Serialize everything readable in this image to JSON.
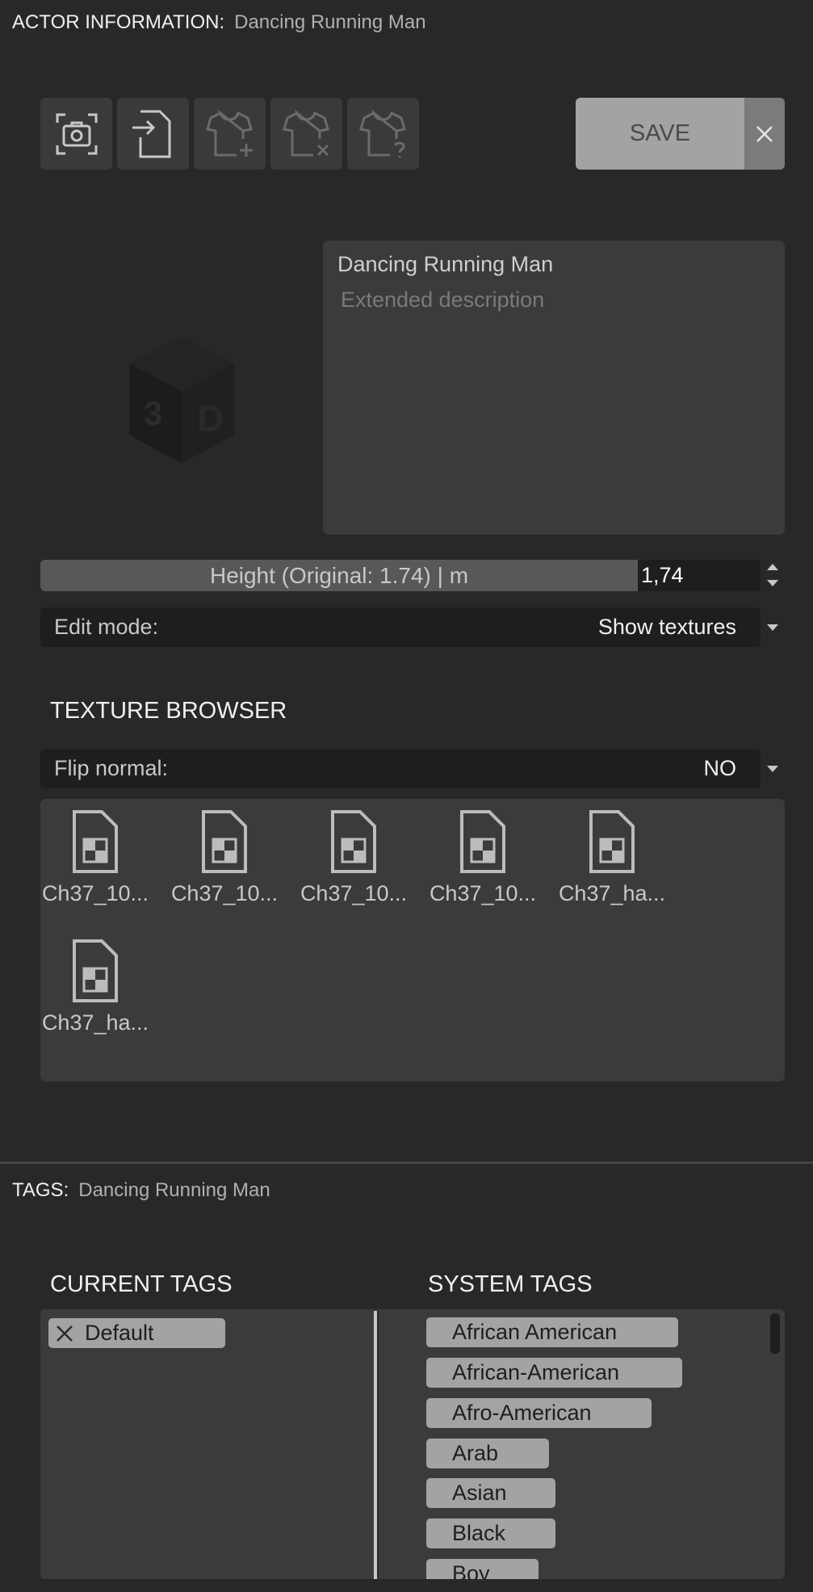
{
  "actor_panel": {
    "header_label": "ACTOR INFORMATION:",
    "header_name": "Dancing Running Man"
  },
  "toolbar": {
    "buttons": [
      {
        "icon": "camera-icon",
        "enabled": true
      },
      {
        "icon": "import-file-icon",
        "enabled": true
      },
      {
        "icon": "shirt-add-icon",
        "enabled": false
      },
      {
        "icon": "shirt-remove-icon",
        "enabled": false
      },
      {
        "icon": "shirt-help-icon",
        "enabled": false
      }
    ],
    "save_label": "SAVE",
    "close_icon": "close-icon"
  },
  "preview": {
    "icon": "3d-cube-icon"
  },
  "description": {
    "title": "Dancing Running Man",
    "placeholder": "Extended description"
  },
  "height": {
    "label": "Height (Original: 1.74) | m",
    "value": "1,74"
  },
  "edit_mode": {
    "label": "Edit mode:",
    "value": "Show textures"
  },
  "texture_browser": {
    "title": "TEXTURE BROWSER",
    "flip_normal_label": "Flip normal:",
    "flip_normal_value": "NO",
    "items": [
      {
        "name": "Ch37_10..."
      },
      {
        "name": "Ch37_10..."
      },
      {
        "name": "Ch37_10..."
      },
      {
        "name": "Ch37_10..."
      },
      {
        "name": "Ch37_ha..."
      },
      {
        "name": "Ch37_ha..."
      }
    ]
  },
  "tags_panel": {
    "header_label": "TAGS:",
    "header_name": "Dancing Running Man",
    "current_title": "CURRENT TAGS",
    "system_title": "SYSTEM TAGS",
    "current_tags": [
      "Default"
    ],
    "system_tags": [
      "African American",
      "African-American",
      "Afro-American",
      "Arab",
      "Asian",
      "Black",
      "Boy"
    ]
  },
  "colors": {
    "background": "#282828",
    "panel": "#3b3b3b",
    "chip": "#a3a3a3",
    "save_button": "#a3a3a3"
  }
}
